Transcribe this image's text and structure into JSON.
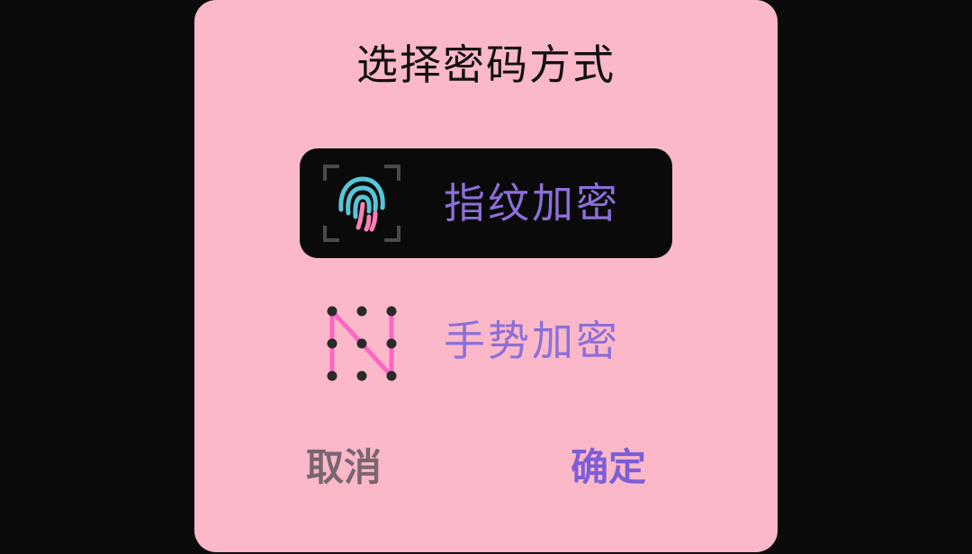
{
  "dialog": {
    "title": "选择密码方式",
    "options": [
      {
        "label": "指纹加密",
        "icon": "fingerprint-icon",
        "selected": true
      },
      {
        "label": "手势加密",
        "icon": "gesture-pattern-icon",
        "selected": false
      }
    ],
    "cancel_label": "取消",
    "confirm_label": "确定"
  },
  "colors": {
    "background": "#0b0b0b",
    "dialog_bg": "#fbb8c8",
    "selected_bg": "#0a0a0a",
    "option_text": "#8c6fd9",
    "confirm_text": "#7e5ed6",
    "cancel_text": "#7a6670",
    "fingerprint_cyan": "#56c6d8",
    "fingerprint_pink": "#ff7fb8",
    "gesture_line": "#ff66c4"
  }
}
